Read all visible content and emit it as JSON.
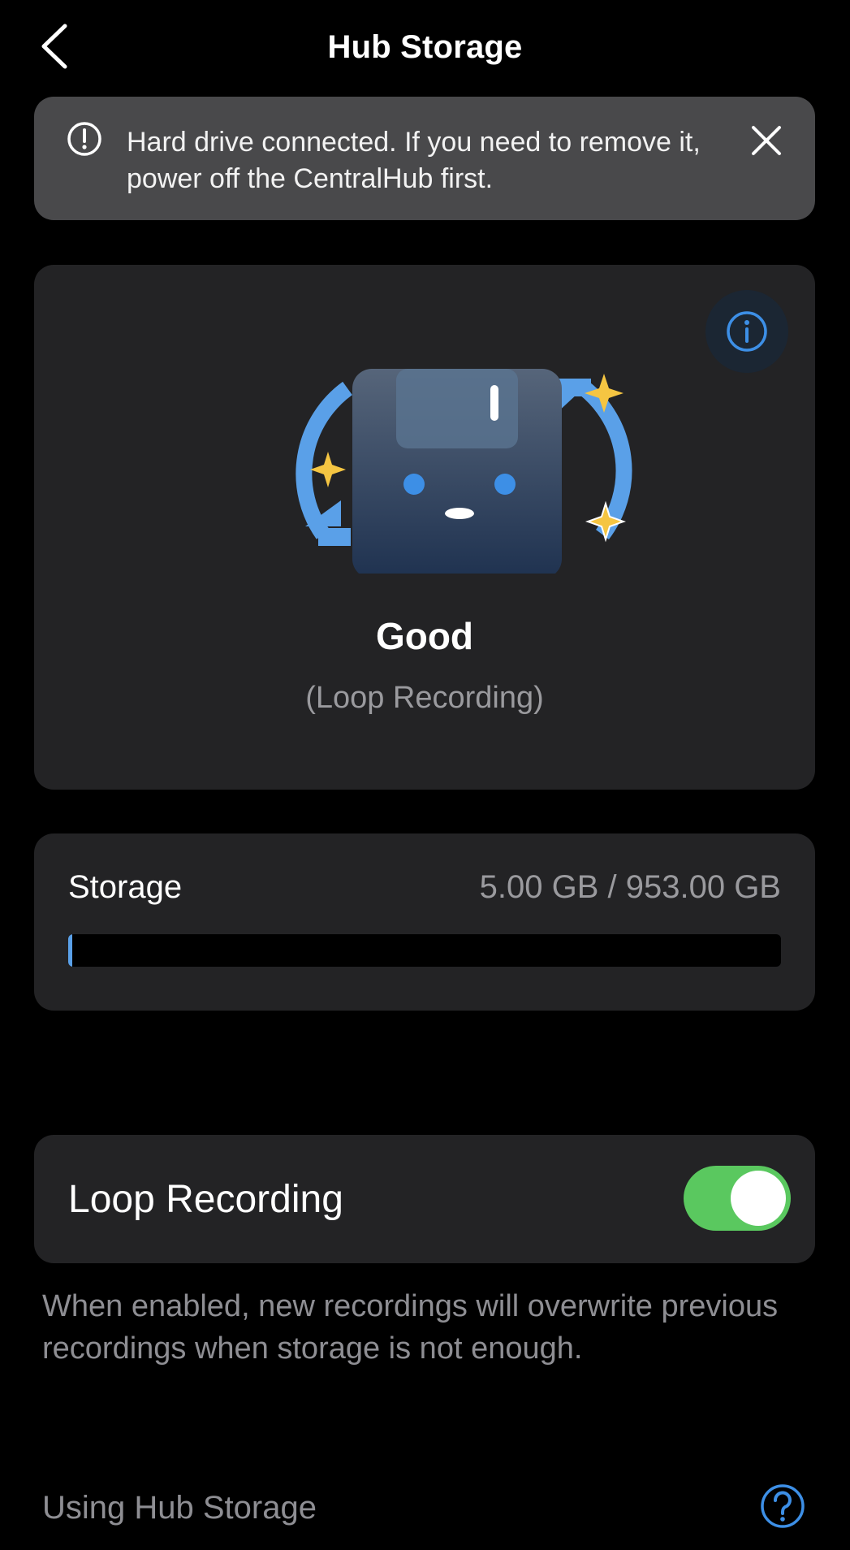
{
  "header": {
    "title": "Hub Storage",
    "back_icon": "chevron-left-icon"
  },
  "banner": {
    "icon": "exclamation-circle-icon",
    "message": "Hard drive connected. If you need to remove it, power off the CentralHub first.",
    "close_icon": "close-icon"
  },
  "status": {
    "info_icon": "info-icon",
    "illustration": "hard-drive-loop-illustration",
    "label": "Good",
    "sublabel": "(Loop Recording)"
  },
  "storage": {
    "label": "Storage",
    "value": "5.00 GB / 953.00 GB",
    "used_fraction": 0.0052
  },
  "loop_recording": {
    "label": "Loop Recording",
    "enabled": true,
    "description": "When enabled, new recordings will overwrite previous recordings when storage is not enough."
  },
  "help": {
    "label": "Using Hub Storage",
    "icon": "question-circle-icon"
  },
  "colors": {
    "background": "#000000",
    "card": "#232325",
    "banner": "#49494b",
    "accent_blue": "#3d8fe6",
    "toggle_on": "#5ac85f",
    "secondary_text": "#8e8e93",
    "sparkle": "#f5c542"
  }
}
